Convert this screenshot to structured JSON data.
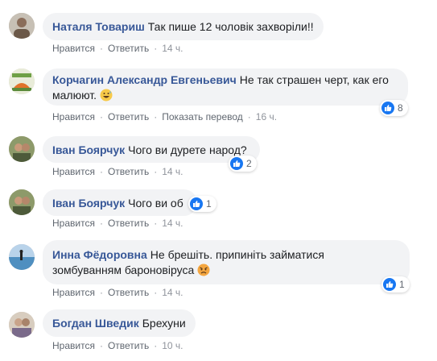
{
  "comments": [
    {
      "author": "Наталя Товариш",
      "text": "Так пише 12 чоловік захворіли!!",
      "actions": [
        "Нравится",
        "Ответить"
      ],
      "time": "14 ч.",
      "reactions": null
    },
    {
      "author": "Корчагин Александр Евгеньевич",
      "text": "Не так страшен черт, как его",
      "text2": "малюют.",
      "emoji": "grinning-sweat-emoji",
      "actions": [
        "Нравится",
        "Ответить",
        "Показать перевод"
      ],
      "time": "16 ч.",
      "reactions": "8"
    },
    {
      "author": "Іван Боярчук",
      "text": "Чого ви дурете народ?",
      "actions": [
        "Нравится",
        "Ответить"
      ],
      "time": "14 ч.",
      "reactions": "2"
    },
    {
      "author": "Іван Боярчук",
      "text": "Чого ви об",
      "actions": [
        "Нравится",
        "Ответить"
      ],
      "time": "14 ч.",
      "reactions": "1"
    },
    {
      "author": "Инна Фёдоровна",
      "text": "Не брешіть. припиніть займатися",
      "text2": "зомбуванням бароновіруса",
      "emoji": "angry-face-emoji",
      "actions": [
        "Нравится",
        "Ответить"
      ],
      "time": "14 ч.",
      "reactions": "1"
    },
    {
      "author": "Богдан Шведик",
      "text": "Брехуни",
      "actions": [
        "Нравится",
        "Ответить"
      ],
      "time": "10 ч.",
      "reactions": null
    }
  ],
  "colors": {
    "author": "#385898",
    "bubble": "#f2f3f5",
    "like": "#1877f2",
    "meta": "#606770"
  },
  "separator": "·"
}
